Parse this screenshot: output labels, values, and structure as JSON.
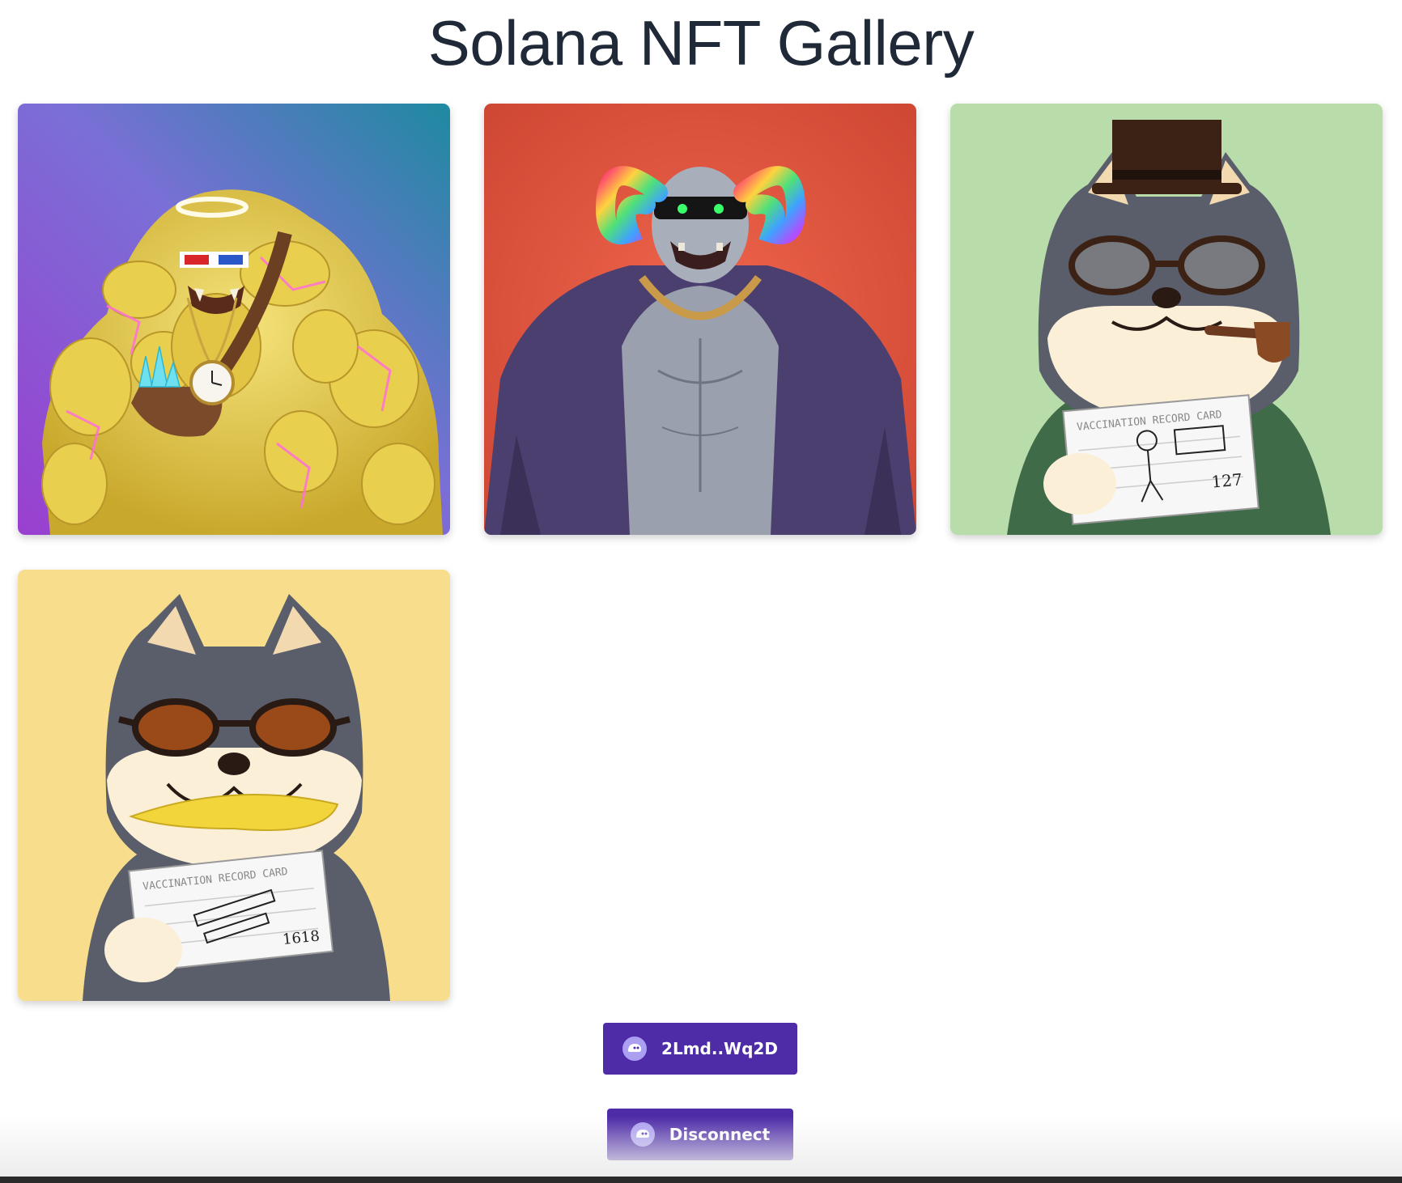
{
  "page": {
    "title": "Solana NFT Gallery"
  },
  "gallery": {
    "cards": [
      {
        "icon": "golem-nft-image",
        "background": "#7a55c9"
      },
      {
        "icon": "ram-horned-brute-nft-image",
        "background": "#e05b46"
      },
      {
        "icon": "shiba-top-hat-pipe-nft-image",
        "background": "#b9ddaa",
        "card_text": "VACCINATION RECORD CARD",
        "card_number": "127"
      },
      {
        "icon": "shiba-sunglasses-banana-nft-image",
        "background": "#f7dd8c",
        "card_text": "VACCINATION RECORD CARD",
        "card_number": "1618"
      }
    ]
  },
  "wallet": {
    "address_label": "2Lmd..Wq2D",
    "disconnect_label": "Disconnect",
    "icon": "phantom-ghost-icon",
    "button_color": "#4e2ca8"
  }
}
